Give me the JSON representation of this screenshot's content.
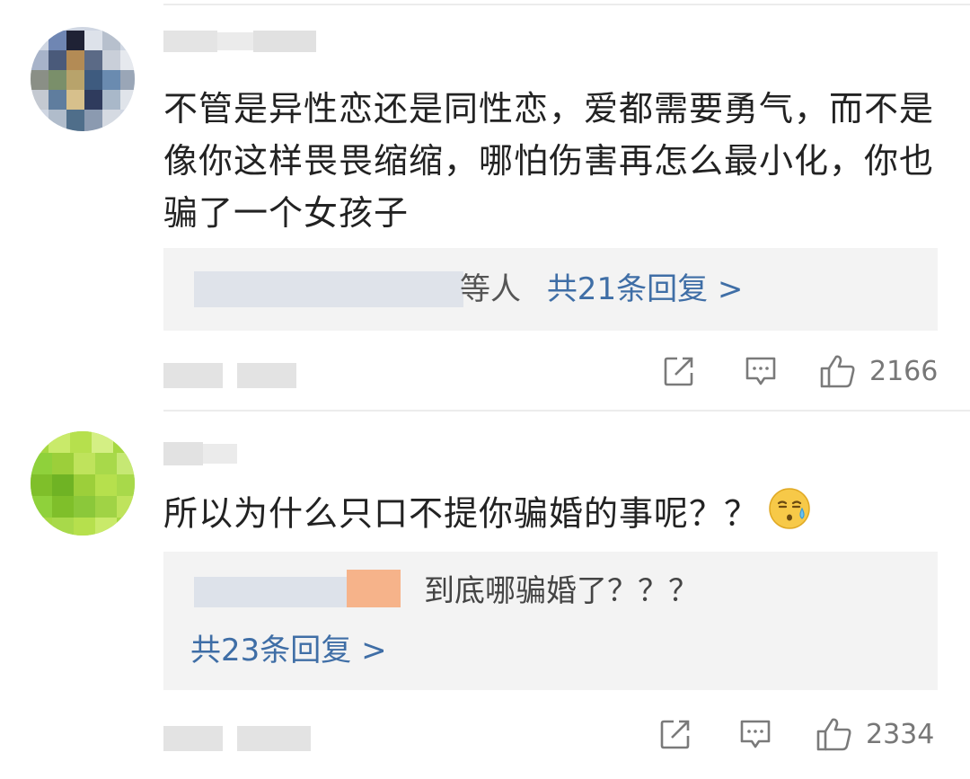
{
  "comments": [
    {
      "text": "不管是异性恋还是同性恋，爱都需要勇气，而不是像你这样畏畏缩缩，哪怕伤害再怎么最小化，你也骗了一个女孩子",
      "replies_suffix": "等人",
      "replies_link": "共21条回复 >",
      "like_count": "2166",
      "avatar_colors": [
        "#6f86b3",
        "#3a3c55",
        "#a7b3c9",
        "#c9cfd9",
        "#8c7b5d",
        "#2f3b5d",
        "#7a8f6a",
        "#b8a36b",
        "#4f6e8a",
        "#5f7d9e",
        "#a9b8c9",
        "#3e5b7f"
      ]
    },
    {
      "text": "所以为什么只口不提你骗婚的事呢？？",
      "emoji": "sweat-face",
      "reply_preview": "到底哪骗婚了？？？",
      "replies_link": "共23条回复 >",
      "like_count": "2334",
      "avatar_colors": [
        "#9ccf3a",
        "#b6e04d",
        "#7fbf2a",
        "#c9ea6a",
        "#8fd13b",
        "#a8d94a",
        "#6fb324",
        "#bfe35c"
      ]
    }
  ],
  "icons": {
    "share": "share-icon",
    "comment": "comment-icon",
    "like": "thumbs-up-icon"
  }
}
